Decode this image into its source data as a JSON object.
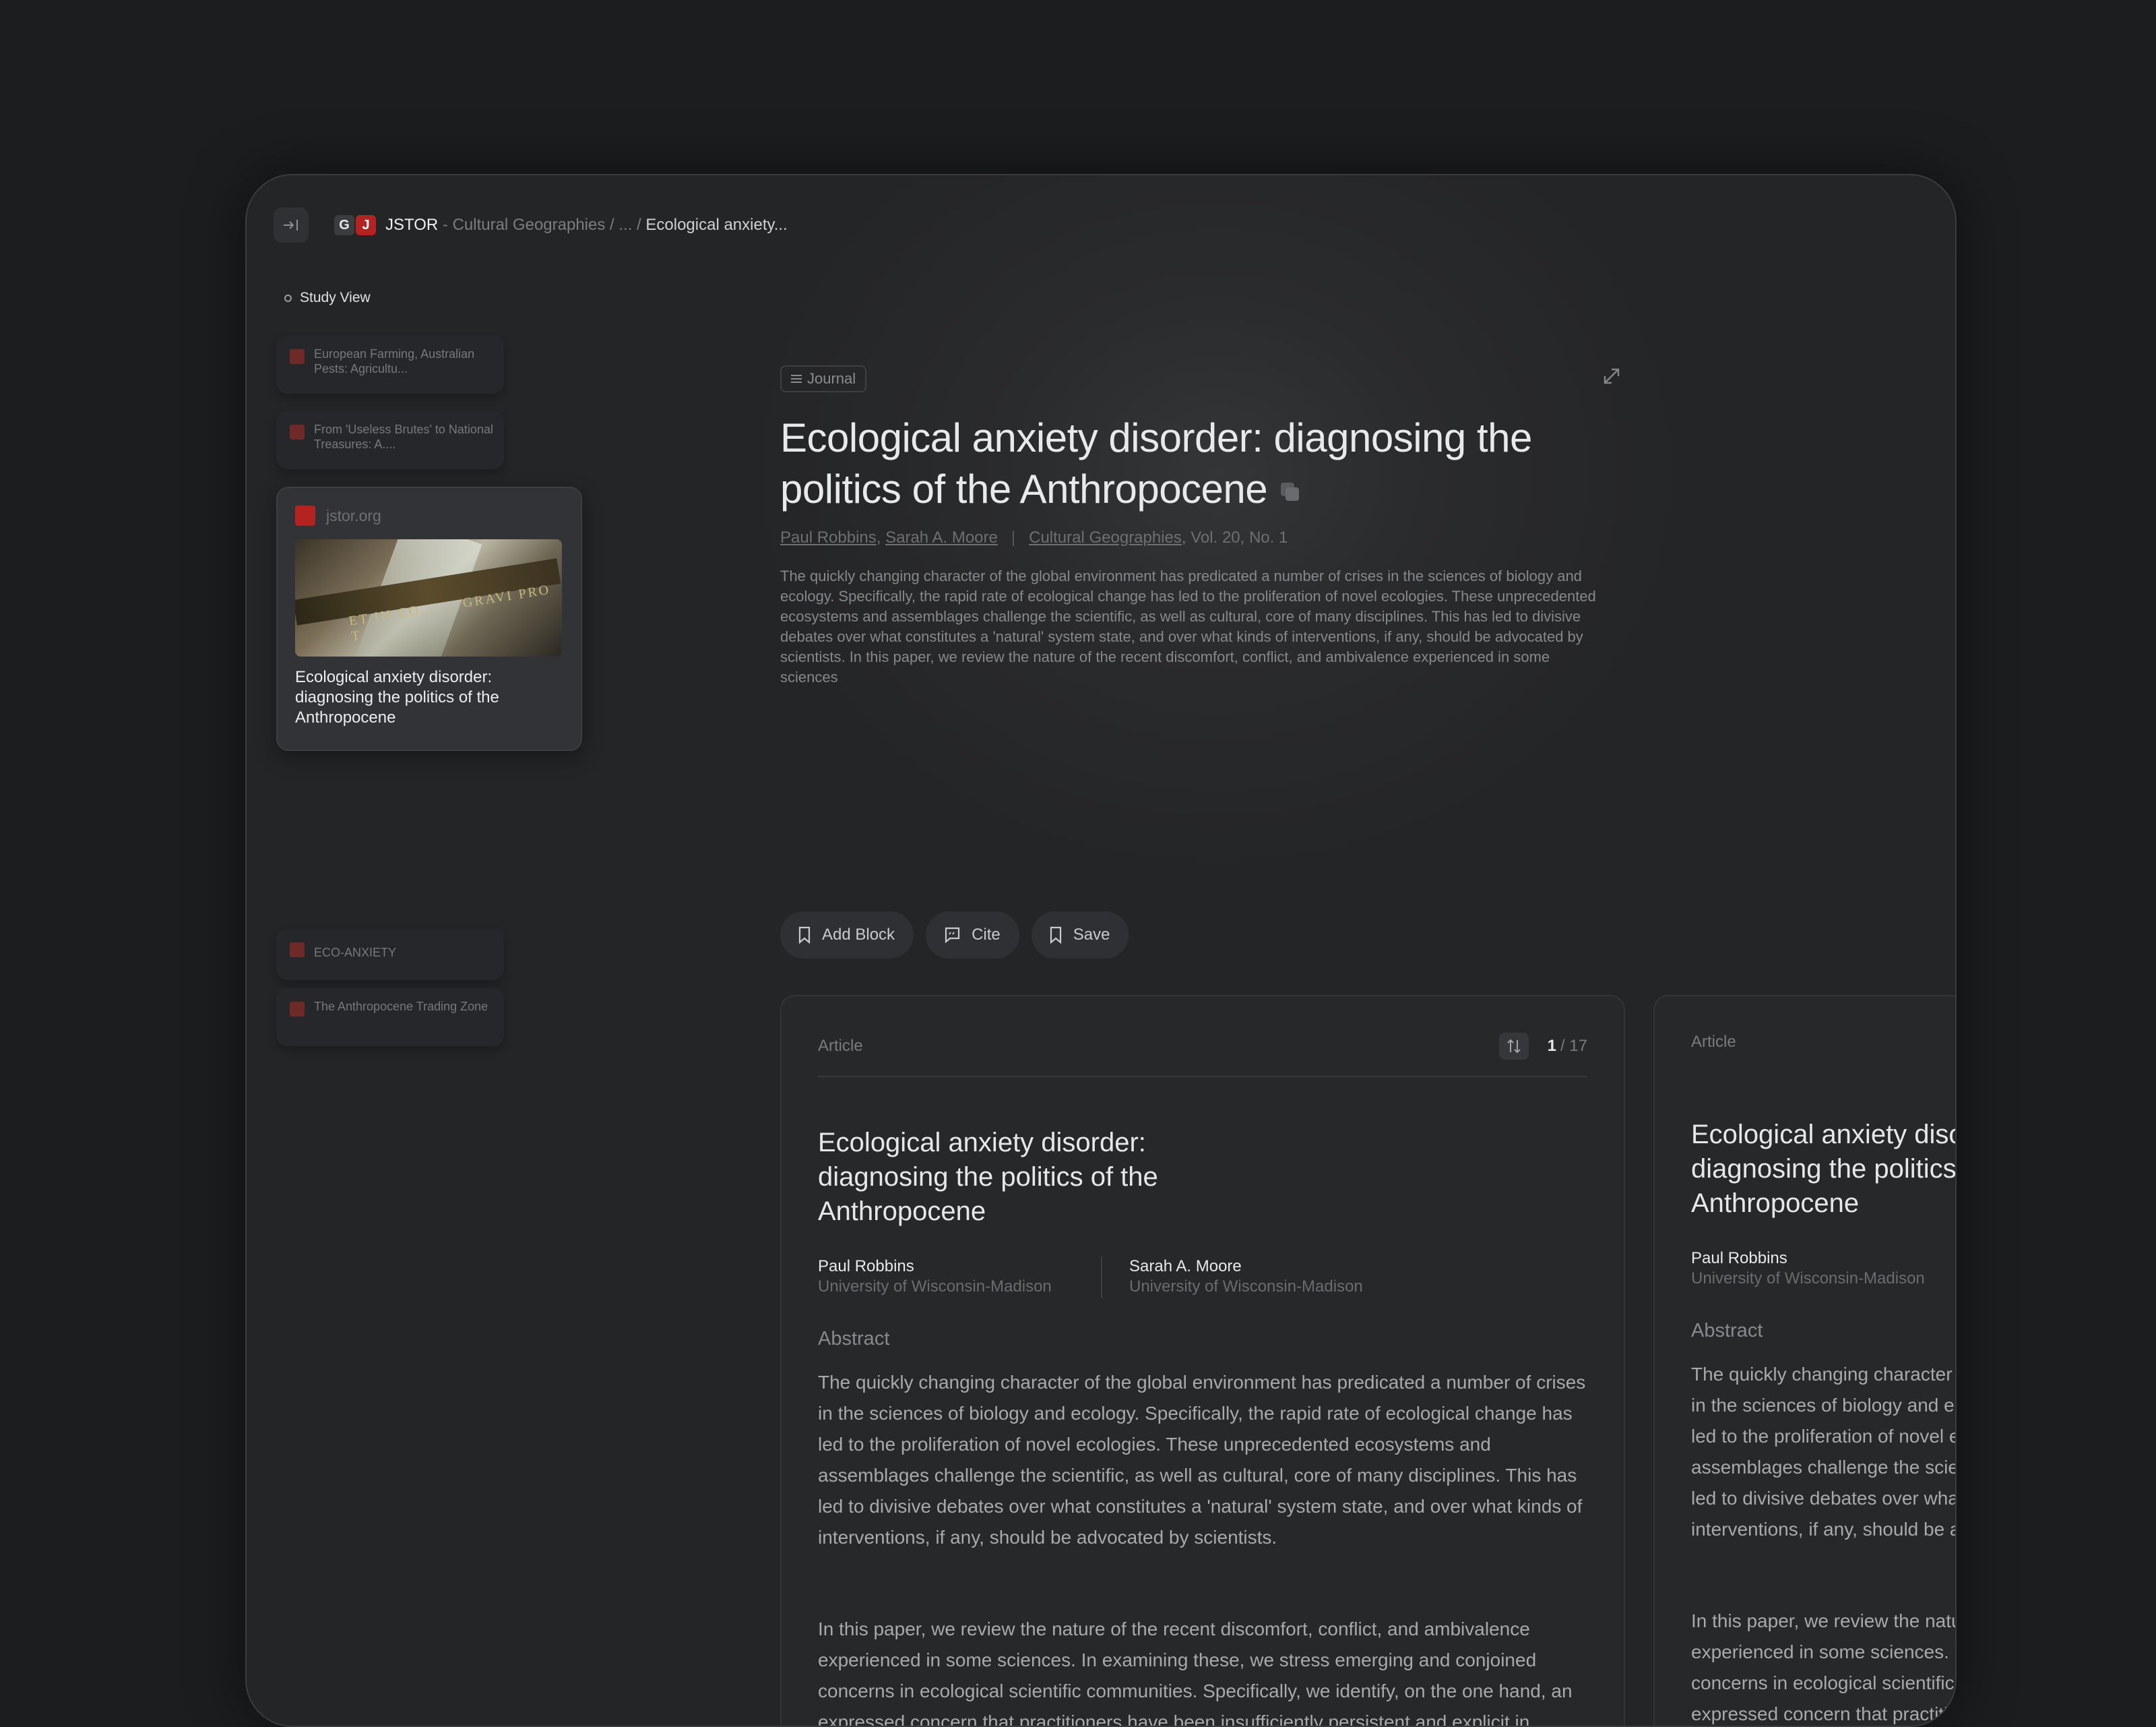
{
  "breadcrumb": {
    "site": "JSTOR",
    "path": " - Cultural Geographies / ... / ",
    "current": "Ecological anxiety...",
    "fav_g": "G",
    "fav_j": "J"
  },
  "sidebar": {
    "study_view": "Study View",
    "items": [
      {
        "label": "European Farming, Australian Pests: Agricultu..."
      },
      {
        "label": "From 'Useless Brutes' to National Treasures: A...."
      },
      {
        "label": "ECO-ANXIETY"
      },
      {
        "label": "The Anthropocene Trading Zone"
      }
    ],
    "active": {
      "domain": "jstor.org",
      "title": "Ecological anxiety disorder: diagnosing the politics of the Anthropocene",
      "image_inscription": "ET IN CO... ... GRAVI PRO T"
    }
  },
  "main": {
    "tag": "Journal",
    "title": "Ecological anxiety disorder: diagnosing the politics of the Anthropocene",
    "authors": [
      "Paul Robbins",
      "Sarah A. Moore"
    ],
    "author_sep": ", ",
    "journal": "Cultural Geographies",
    "volume": ", Vol. 20, No. 1",
    "abstract": "The quickly changing character of the global environment has predicated a number of crises in the sciences of biology and ecology. Specifically, the rapid rate of ecological change has led to the proliferation of novel ecologies. These unprecedented ecosystems and assemblages challenge the scientific, as well as cultural, core of many disciplines. This has led to divisive debates over what constitutes a 'natural' system state, and over what kinds of interventions, if any, should be advocated by scientists. In this paper, we review the nature of the recent discomfort, conflict, and ambivalence experienced in some sciences",
    "actions": {
      "add_block": "Add Block",
      "cite": "Cite",
      "save": "Save"
    }
  },
  "article": {
    "label": "Article",
    "page_current": "1",
    "page_total": " / 17",
    "title": "Ecological anxiety disorder: diagnosing the politics of the Anthropocene",
    "authors": [
      {
        "name": "Paul Robbins",
        "affiliation": "University of Wisconsin-Madison"
      },
      {
        "name": "Sarah A. Moore",
        "affiliation": "University of Wisconsin-Madison"
      }
    ],
    "abstract_heading": "Abstract",
    "paragraphs": [
      "The quickly changing character of the global environment has predicated a number of crises in the sciences of biology and ecology. Specifically, the rapid rate of ecological change has led to the proliferation of novel ecologies. These unprecedented ecosystems and assemblages challenge the scientific, as well as cultural, core of many disciplines. This has led to divisive debates over what constitutes a 'natural' system state, and over what kinds of interventions, if any, should be advocated by scientists.",
      "In this paper, we review the nature of the recent discomfort, conflict, and ambivalence experienced in some sciences. In examining these, we stress emerging and conjoined concerns in ecological scientific communities. Specifically, we identify, on the one hand, an expressed concern that practitioners have been insufficiently persistent and explicit in proselytizing the current risks of human impacts, and on the other hand an obverse concern that many historically common scientific concepts"
    ]
  },
  "colors": {
    "accent_red": "#b4231f",
    "background": "#1c1d1f",
    "panel": "#27282a"
  }
}
